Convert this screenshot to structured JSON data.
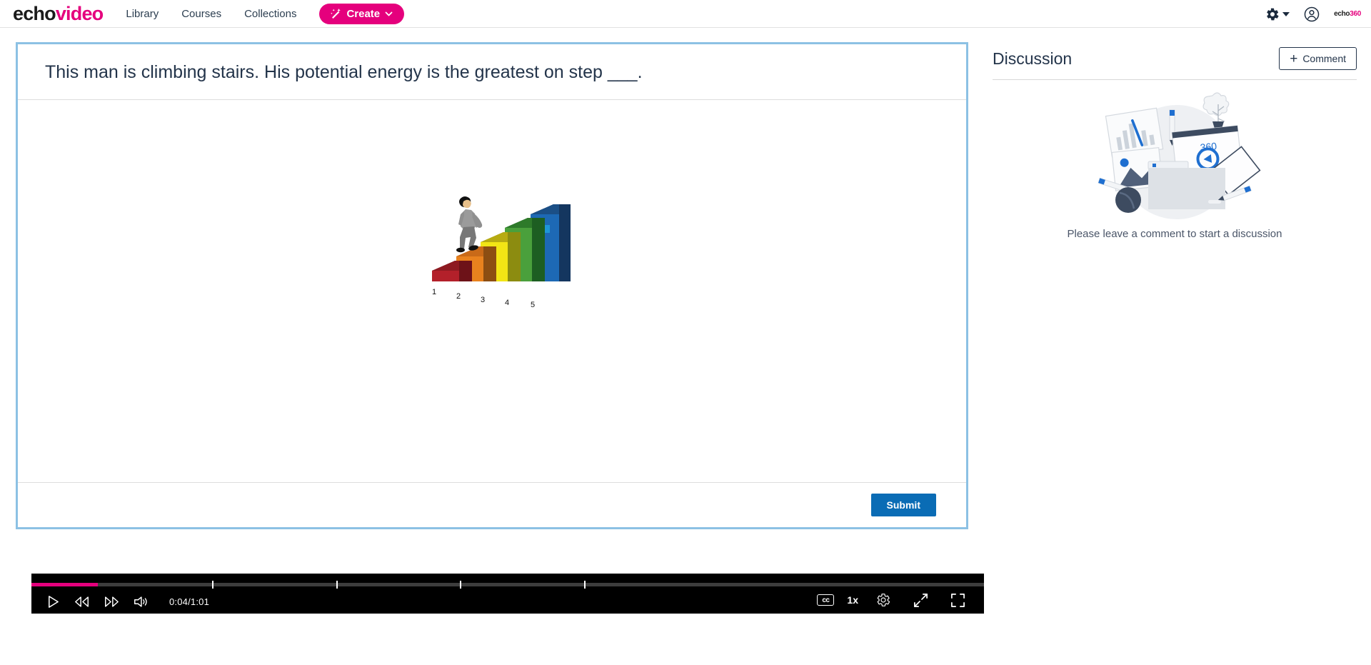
{
  "nav": {
    "brand_part1": "echo",
    "brand_part2": "video",
    "links": [
      {
        "label": "Library"
      },
      {
        "label": "Courses"
      },
      {
        "label": "Collections"
      }
    ],
    "create_label": "Create",
    "logo_part1": "echo",
    "logo_part2": "360"
  },
  "question": {
    "title": "This man is climbing stairs. His potential energy is the greatest on step ___.",
    "submit_label": "Submit",
    "figure": {
      "alt": "Man climbing five colored 3D steps of increasing height",
      "step_labels": [
        "1",
        "2",
        "3",
        "4",
        "5"
      ],
      "step_colors": [
        "#b3202a",
        "#e8821e",
        "#f2e515",
        "#4aa03c",
        "#1d69b5"
      ],
      "marker_color": "#1e96d8"
    }
  },
  "player": {
    "time_current": "0:04",
    "time_total": "1:01",
    "time_display": "0:04/1:01",
    "progress_percent": 7,
    "chapter_marks_percent": [
      19,
      32,
      45,
      58
    ],
    "speed_label": "1x",
    "cc_label": "cc",
    "accent_color": "#e5007d"
  },
  "discussion": {
    "title": "Discussion",
    "comment_button_label": "Comment",
    "empty_message": "Please leave a comment to start a discussion"
  }
}
